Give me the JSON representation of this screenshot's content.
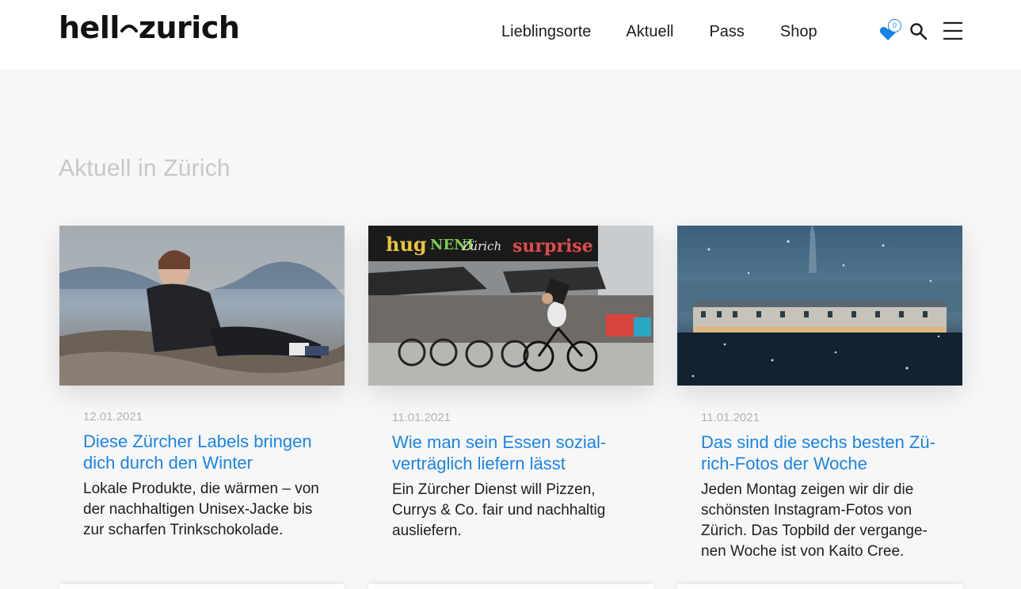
{
  "header": {
    "logo_left": "hell",
    "logo_right": "zurich",
    "nav": [
      {
        "label": "Lieblingsorte"
      },
      {
        "label": "Aktuell"
      },
      {
        "label": "Pass"
      },
      {
        "label": "Shop"
      }
    ],
    "favorites_count": "0",
    "icons": {
      "favorites": "heart-icon",
      "search": "search-icon",
      "menu": "hamburger-menu-icon"
    },
    "accent_color": "#1a84e8"
  },
  "section": {
    "title": "Aktuell in Zürich"
  },
  "articles": [
    {
      "date": "12.01.2021",
      "title": "Diese Zürcher Labels bringen dich durch den Winter",
      "teaser": "Lokale Produkte, die wärmen – von der nachhaltigen Unisex-Jacke bis zur scharfen Trinkschokolade."
    },
    {
      "date": "11.01.2021",
      "title": "Wie man sein Essen sozial-verträglich liefern lässt",
      "teaser": "Ein Zürcher Dienst will Pizzen, Currys & Co. fair und nachhaltig ausliefern.",
      "image_signs": [
        "hug",
        "NENI",
        "Zürich",
        "surprise"
      ]
    },
    {
      "date": "11.01.2021",
      "title": "Das sind die sechs besten Zü-rich-Fotos der Woche",
      "teaser": "Jeden Montag zeigen wir dir die schönsten Instagram-Fotos von Zürich. Das Topbild der vergange-nen Woche ist von Kaito Cree."
    }
  ]
}
